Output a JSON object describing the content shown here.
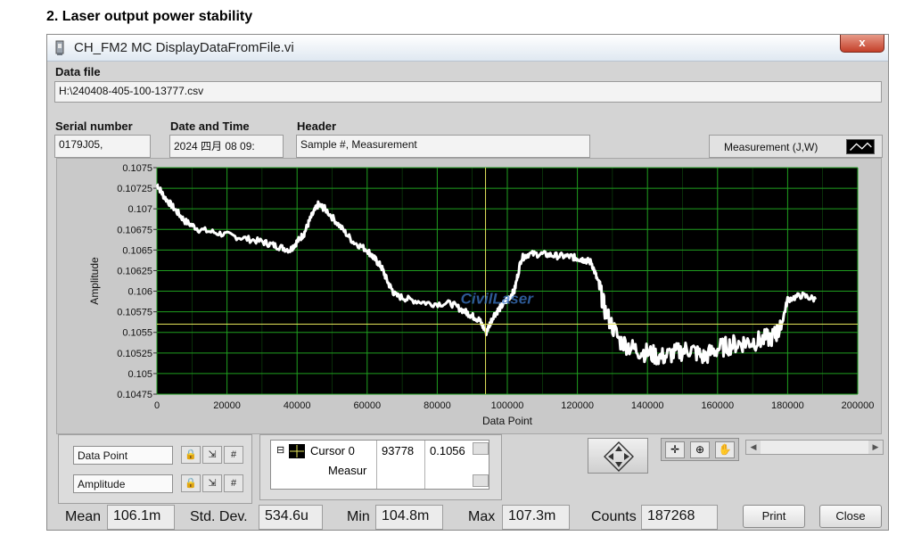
{
  "doc_heading": "2.    Laser output power stability",
  "window": {
    "title": "CH_FM2 MC DisplayDataFromFile.vi",
    "close_label": "x",
    "app_icon": "labview-vi-icon"
  },
  "data_file": {
    "label": "Data file",
    "value": "H:\\240408-405-100-13777.csv"
  },
  "serial_number": {
    "label": "Serial number",
    "value": "0179J05,"
  },
  "date_time": {
    "label": "Date and Time",
    "value": "2024 四月 08 09:"
  },
  "header": {
    "label": "Header",
    "value": "Sample #, Measurement"
  },
  "legend": {
    "label": "Measurement (J,W)"
  },
  "chart_data": {
    "type": "line",
    "xlabel": "Data Point",
    "ylabel": "Amplitude",
    "xlim": [
      0,
      200000
    ],
    "ylim": [
      0.10475,
      0.1075
    ],
    "x_ticks": [
      0,
      20000,
      40000,
      60000,
      80000,
      100000,
      120000,
      140000,
      160000,
      180000,
      200000
    ],
    "y_ticks": [
      0.10475,
      0.105,
      0.10525,
      0.1055,
      0.10575,
      0.106,
      0.10625,
      0.1065,
      0.10675,
      0.107,
      0.10725,
      0.1075
    ],
    "y_tick_labels": [
      "0.10475",
      "0.105",
      "0.10525",
      "0.1055",
      "0.10575",
      "0.106",
      "0.10625",
      "0.1065",
      "0.10675",
      "0.107",
      "0.10725",
      "0.1075"
    ],
    "grid": true,
    "background": "#000000",
    "grid_color": "#1f9e1f",
    "series": [
      {
        "color": "#ffffff",
        "x": [
          0,
          2000,
          5000,
          8000,
          12000,
          18000,
          24000,
          30000,
          34000,
          38000,
          40000,
          42000,
          44000,
          46000,
          48000,
          52000,
          56000,
          60000,
          62000,
          64000,
          66000,
          68000,
          72000,
          78000,
          84000,
          88000,
          90000,
          92000,
          94000,
          96000,
          98000,
          100000,
          102000,
          104000,
          106000,
          110000,
          114000,
          118000,
          120000,
          122000,
          124000,
          126000,
          128000,
          132000,
          136000,
          140000,
          144000,
          148000,
          152000,
          156000,
          160000,
          164000,
          168000,
          172000,
          176000,
          178000,
          180000,
          184000,
          188000
        ],
        "y": [
          0.1073,
          0.10715,
          0.107,
          0.10685,
          0.10675,
          0.1067,
          0.10665,
          0.1066,
          0.10655,
          0.1065,
          0.1066,
          0.1067,
          0.1069,
          0.10705,
          0.107,
          0.1068,
          0.1066,
          0.1065,
          0.1064,
          0.1063,
          0.1061,
          0.10595,
          0.1059,
          0.10585,
          0.10585,
          0.10575,
          0.1057,
          0.10565,
          0.1055,
          0.1057,
          0.1058,
          0.1059,
          0.106,
          0.1064,
          0.10645,
          0.10645,
          0.10643,
          0.10642,
          0.1064,
          0.10638,
          0.10635,
          0.1061,
          0.10575,
          0.1054,
          0.1053,
          0.10525,
          0.1052,
          0.10525,
          0.1053,
          0.1052,
          0.1053,
          0.10535,
          0.10538,
          0.1054,
          0.10545,
          0.10555,
          0.1059,
          0.10595,
          0.1059
        ]
      }
    ],
    "cursor": {
      "x": 93778,
      "y": 0.1056,
      "color": "#e3e35a"
    }
  },
  "x_scale": {
    "name": "Data Point"
  },
  "y_scale": {
    "name": "Amplitude"
  },
  "cursor_panel": {
    "name": "Cursor 0",
    "x_value": "93778",
    "y_value": "0.1056",
    "row2": "Measur"
  },
  "stats": {
    "mean_label": "Mean",
    "mean_value": "106.1m",
    "std_label": "Std. Dev.",
    "std_value": "534.6u",
    "min_label": "Min",
    "min_value": "104.8m",
    "max_label": "Max",
    "max_value": "107.3m",
    "counts_label": "Counts",
    "counts_value": "187268"
  },
  "buttons": {
    "print": "Print",
    "close": "Close"
  },
  "watermark_text": "CivilLaser"
}
